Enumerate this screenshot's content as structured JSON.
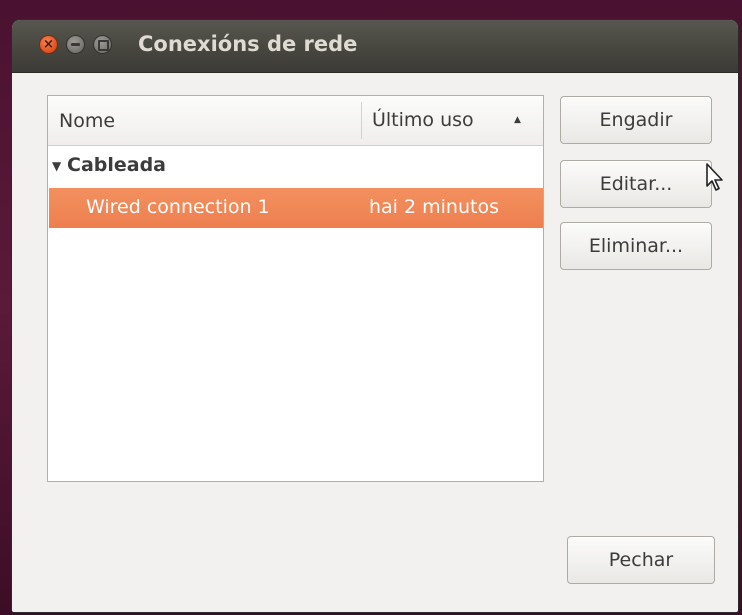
{
  "window": {
    "title": "Conexións de rede"
  },
  "list": {
    "columns": {
      "name": "Nome",
      "last_used": "Último uso",
      "sort_indicator": "▲"
    },
    "group": {
      "expander": "▼",
      "label": "Cableada"
    },
    "connections": [
      {
        "name": "Wired connection 1",
        "last_used": "hai 2 minutos",
        "selected": true
      }
    ]
  },
  "buttons": {
    "add": "Engadir",
    "edit": "Editar...",
    "delete": "Eliminar...",
    "close": "Pechar"
  },
  "colors": {
    "selection": "#f07746",
    "titlebar": "#45443f",
    "close_button": "#e25a26"
  }
}
